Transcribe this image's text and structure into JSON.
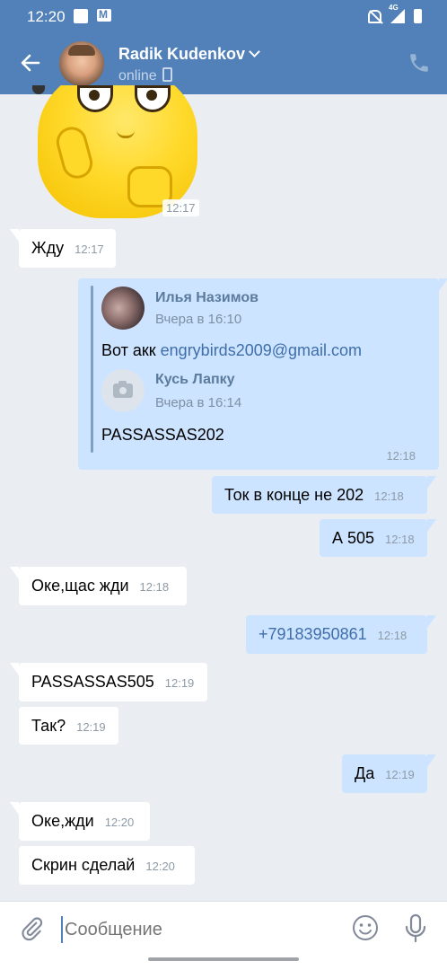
{
  "status_bar": {
    "time": "12:20",
    "network": "4G"
  },
  "header": {
    "contact_name": "Radik Kudenkov",
    "status": "online"
  },
  "sticker": {
    "time": "12:17"
  },
  "messages": [
    {
      "text": "Жду",
      "time": "12:17",
      "dir": "in"
    },
    {
      "text": "Ток в конце не 202",
      "time": "12:18",
      "dir": "out"
    },
    {
      "text": "А 505",
      "time": "12:18",
      "dir": "out"
    },
    {
      "text": "Оке,щас жди",
      "time": "12:18",
      "dir": "in"
    },
    {
      "text": "+79183950861",
      "time": "12:18",
      "dir": "out"
    },
    {
      "text": "PASSASSAS505",
      "time": "12:19",
      "dir": "in"
    },
    {
      "text": "Так?",
      "time": "12:19",
      "dir": "in"
    },
    {
      "text": "Да",
      "time": "12:19",
      "dir": "out"
    },
    {
      "text": "Оке,жди",
      "time": "12:20",
      "dir": "in"
    },
    {
      "text": "Скрин сделай",
      "time": "12:20",
      "dir": "in"
    }
  ],
  "forwarded": {
    "first": {
      "author": "Илья Назимов",
      "date": "Вчера в 16:10",
      "text_prefix": "Вот акк",
      "link": "engrybirds2009@gmail.com"
    },
    "second": {
      "author": "Кусь Лапку",
      "date": "Вчера в 16:14",
      "text": "PASSASSAS202"
    },
    "time": "12:18"
  },
  "composer": {
    "placeholder": "Сообщение"
  },
  "colors": {
    "header": "#5181b8",
    "outgoing": "#cce4ff",
    "incoming": "#ffffff",
    "link": "#3f6eaa"
  }
}
